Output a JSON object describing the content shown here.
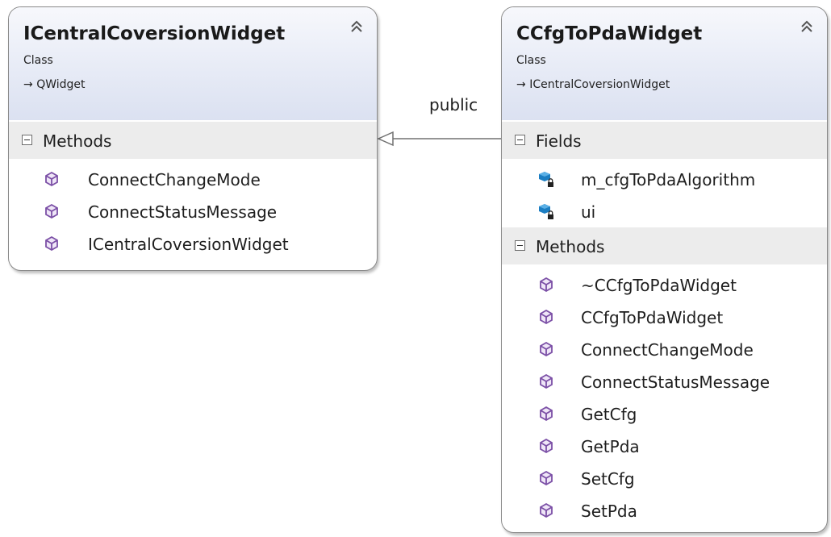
{
  "relationship": {
    "label": "public"
  },
  "left_class": {
    "title": "ICentralCoversionWidget",
    "stereotype": "Class",
    "base": "QWidget",
    "methods_label": "Methods",
    "methods": [
      "ConnectChangeMode",
      "ConnectStatusMessage",
      "ICentralCoversionWidget"
    ]
  },
  "right_class": {
    "title": "CCfgToPdaWidget",
    "stereotype": "Class",
    "base": "ICentralCoversionWidget",
    "fields_label": "Fields",
    "fields": [
      "m_cfgToPdaAlgorithm",
      "ui"
    ],
    "methods_label": "Methods",
    "methods": [
      "~CCfgToPdaWidget",
      "CCfgToPdaWidget",
      "ConnectChangeMode",
      "ConnectStatusMessage",
      "GetCfg",
      "GetPda",
      "SetCfg",
      "SetPda"
    ]
  },
  "icons": {
    "collapse": "double-chevron-up-icon",
    "method": "method-cube-icon",
    "field": "private-field-icon",
    "inherit": "arrow-right-icon"
  },
  "colors": {
    "method_icon": "#7b4fa6",
    "field_icon": "#1c7ec2",
    "header_gradient_top": "#f7f8fc",
    "header_gradient_bottom": "#dbe1f1"
  }
}
